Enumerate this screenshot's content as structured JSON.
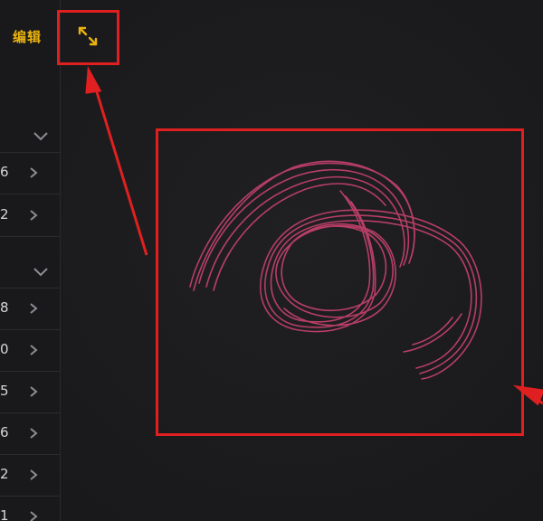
{
  "toolbar": {
    "edit_label": "编辑",
    "expand_icon": "expand-arrows-icon",
    "accent_color": "#e9b30e"
  },
  "sidebar": {
    "sections": [
      {
        "chevron": "chevron-down-icon",
        "rows": [
          "6",
          "2"
        ]
      },
      {
        "chevron": "chevron-down-icon",
        "rows": [
          "8",
          "0",
          "5",
          "6",
          "2",
          "1"
        ]
      }
    ]
  },
  "drawing": {
    "stroke_color": "#c0406a",
    "description_icon": "scribble-drawing"
  },
  "annotations": {
    "highlight_color": "#e02020"
  }
}
